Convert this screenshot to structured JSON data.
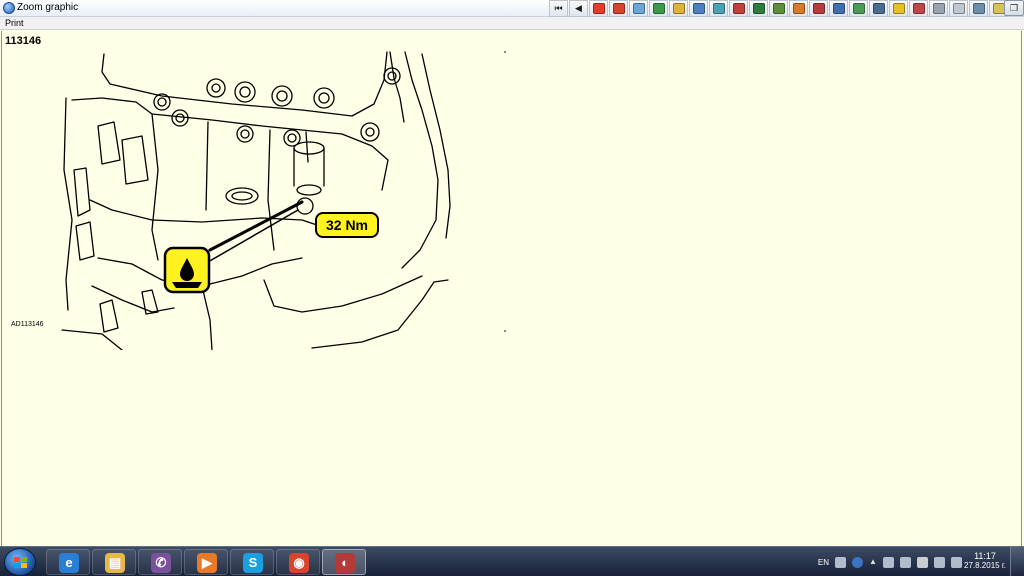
{
  "window": {
    "title": "Zoom graphic",
    "buttons": [
      "minimize",
      "maximize",
      "close"
    ]
  },
  "toolbar": {
    "buttons": [
      {
        "name": "first-page",
        "glyph": "⏮",
        "color": "#1a1a1a"
      },
      {
        "name": "previous",
        "glyph": "◀",
        "color": "#1a1a1a"
      },
      {
        "name": "warning",
        "glyph": "",
        "color": "#e53b2a"
      },
      {
        "name": "tool-1",
        "glyph": "",
        "color": "#d8432c"
      },
      {
        "name": "tool-2",
        "glyph": "",
        "color": "#6aa6d9"
      },
      {
        "name": "tool-3",
        "glyph": "",
        "color": "#3a9a4a"
      },
      {
        "name": "tool-4",
        "glyph": "",
        "color": "#e0b23a"
      },
      {
        "name": "tool-5",
        "glyph": "",
        "color": "#4b7fc4"
      },
      {
        "name": "tool-6",
        "glyph": "",
        "color": "#4aa3b5"
      },
      {
        "name": "tool-7",
        "glyph": "",
        "color": "#c2403a"
      },
      {
        "name": "tool-8",
        "glyph": "",
        "color": "#2f7b3f"
      },
      {
        "name": "tool-9",
        "glyph": "",
        "color": "#5c8e3b"
      },
      {
        "name": "tool-10",
        "glyph": "",
        "color": "#d97a2a"
      },
      {
        "name": "tool-11",
        "glyph": "",
        "color": "#b53c3c"
      },
      {
        "name": "tool-12",
        "glyph": "",
        "color": "#3f6fb0"
      },
      {
        "name": "tool-13",
        "glyph": "",
        "color": "#4c9a57"
      },
      {
        "name": "tool-14",
        "glyph": "",
        "color": "#4a6d8f"
      },
      {
        "name": "tool-15",
        "glyph": "",
        "color": "#e5c125"
      },
      {
        "name": "tool-16",
        "glyph": "",
        "color": "#c04646"
      },
      {
        "name": "tool-17",
        "glyph": "",
        "color": "#9aa4b1"
      },
      {
        "name": "tool-18",
        "glyph": "",
        "color": "#bfc7d2"
      },
      {
        "name": "tool-19",
        "glyph": "",
        "color": "#6d8fae"
      },
      {
        "name": "tool-20",
        "glyph": "",
        "color": "#d8c25a"
      }
    ]
  },
  "menu": {
    "print": "Print"
  },
  "figure": {
    "number": "113146",
    "code": "AD113146",
    "torque": "32 Nm",
    "torque_color": "#fff21f"
  },
  "taskbar": {
    "apps": [
      {
        "name": "internet-explorer",
        "glyph": "e",
        "color": "#2a7fd4"
      },
      {
        "name": "file-explorer",
        "glyph": "▤",
        "color": "#e5b84a"
      },
      {
        "name": "viber",
        "glyph": "✆",
        "color": "#7b519d"
      },
      {
        "name": "media-player",
        "glyph": "▶",
        "color": "#e8792a"
      },
      {
        "name": "skype",
        "glyph": "S",
        "color": "#1aa0e0"
      },
      {
        "name": "chrome",
        "glyph": "◉",
        "color": "#d9442f"
      },
      {
        "name": "active-app",
        "glyph": "◐",
        "color": "#b43a3a"
      }
    ],
    "language": "EN",
    "time": "11:17",
    "date": "27.8.2015 г."
  }
}
